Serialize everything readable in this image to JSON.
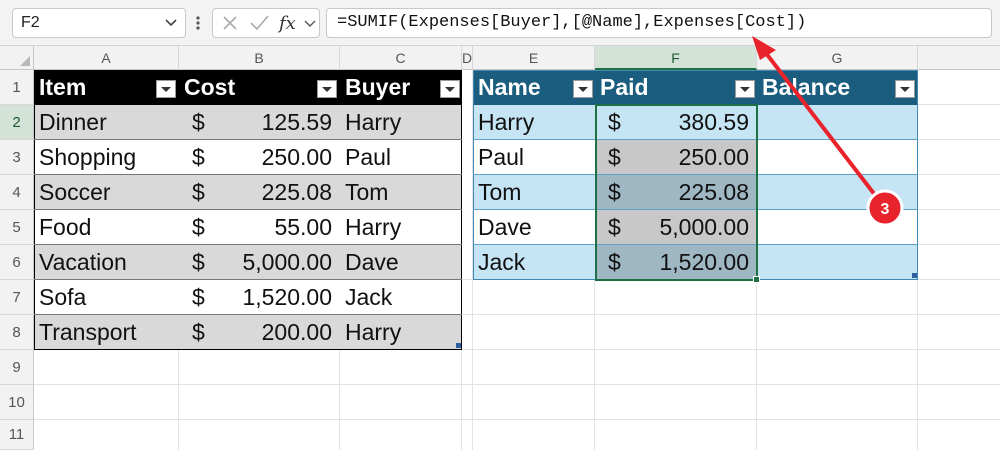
{
  "formula_bar": {
    "name_box": "F2",
    "formula": "=SUMIF(Expenses[Buyer],[@Name],Expenses[Cost])",
    "icons": [
      "chevron-down-icon",
      "more-options-icon",
      "cancel-icon",
      "enter-check-icon",
      "insert-function-icon"
    ]
  },
  "columns": {
    "a": "A",
    "b": "B",
    "c": "C",
    "d": "D",
    "e": "E",
    "f": "F",
    "g": "G"
  },
  "rows": [
    "1",
    "2",
    "3",
    "4",
    "5",
    "6",
    "7",
    "8",
    "9",
    "10",
    "11"
  ],
  "expenses_table": {
    "headers": {
      "item": "Item",
      "cost": "Cost",
      "buyer": "Buyer"
    },
    "rows": [
      {
        "item": "Dinner",
        "currency": "$",
        "cost": "125.59",
        "buyer": "Harry"
      },
      {
        "item": "Shopping",
        "currency": "$",
        "cost": "250.00",
        "buyer": "Paul"
      },
      {
        "item": "Soccer",
        "currency": "$",
        "cost": "225.08",
        "buyer": "Tom"
      },
      {
        "item": "Food",
        "currency": "$",
        "cost": "55.00",
        "buyer": "Harry"
      },
      {
        "item": "Vacation",
        "currency": "$",
        "cost": "5,000.00",
        "buyer": "Dave"
      },
      {
        "item": "Sofa",
        "currency": "$",
        "cost": "1,520.00",
        "buyer": "Jack"
      },
      {
        "item": "Transport",
        "currency": "$",
        "cost": "200.00",
        "buyer": "Harry"
      }
    ]
  },
  "balance_table": {
    "headers": {
      "name": "Name",
      "paid": "Paid",
      "balance": "Balance"
    },
    "rows": [
      {
        "name": "Harry",
        "currency": "$",
        "paid": "380.59",
        "balance": ""
      },
      {
        "name": "Paul",
        "currency": "$",
        "paid": "250.00",
        "balance": ""
      },
      {
        "name": "Tom",
        "currency": "$",
        "paid": "225.08",
        "balance": ""
      },
      {
        "name": "Dave",
        "currency": "$",
        "paid": "5,000.00",
        "balance": ""
      },
      {
        "name": "Jack",
        "currency": "$",
        "paid": "1,520.00",
        "balance": ""
      }
    ]
  },
  "annotation": {
    "step": "3",
    "color": "#e8232b"
  },
  "colors": {
    "expenses_header": "#000000",
    "balance_header": "#1b5d7f",
    "selection": "#1e7145",
    "band_gray": "#d9d9d9",
    "band_blue": "#c5e4f4"
  }
}
